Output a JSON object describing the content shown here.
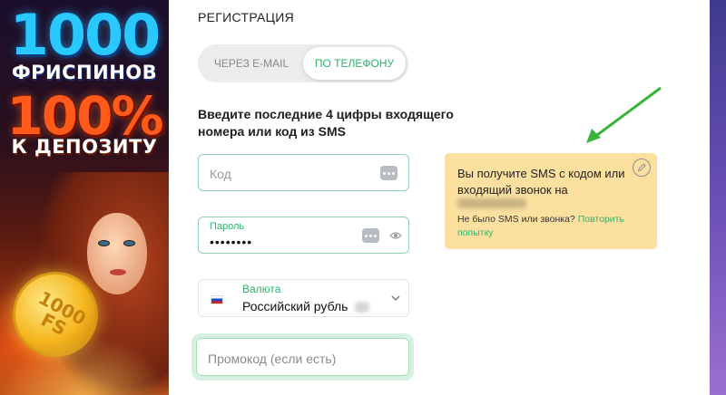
{
  "promo": {
    "big_number": "1000",
    "freespins": "ФРИСПИНОВ",
    "percent": "100%",
    "deposit": "К ДЕПОЗИТУ",
    "coin_text": "1000 FS"
  },
  "form": {
    "title": "РЕГИСТРАЦИЯ",
    "tabs": [
      {
        "label": "ЧЕРЕЗ E-MAIL",
        "active": false
      },
      {
        "label": "ПО ТЕЛЕФОНУ",
        "active": true
      }
    ],
    "instruction": "Введите последние 4 цифры входящего номера или код из SMS",
    "code_field": {
      "placeholder": "Код",
      "value": ""
    },
    "password_field": {
      "label": "Пароль",
      "value": "••••••••"
    },
    "currency_field": {
      "label": "Валюта",
      "value": "Российский рубль"
    },
    "promo_field": {
      "placeholder": "Промокод (если есть)",
      "value": ""
    }
  },
  "info": {
    "text": "Вы получите SMS с кодом или входящий звонок на",
    "no_sms": "Не было SMS или звонка?",
    "retry_link": "Повторить попытку"
  },
  "colors": {
    "accent_green": "#2fb36a",
    "info_background": "#fbe0a0",
    "field_border": "#8ed3a9"
  },
  "icons": [
    "dots-icon",
    "eye-icon",
    "chevron-down-icon",
    "edit-icon",
    "ru-flag-icon",
    "arrow-icon"
  ]
}
